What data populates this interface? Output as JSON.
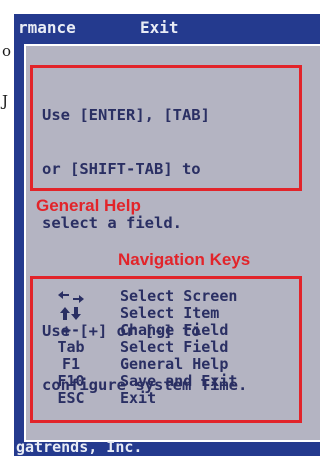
{
  "outside": {
    "frag_1": "o",
    "frag_2": "J"
  },
  "menu": {
    "tab_performance": "rmance",
    "tab_exit": "Exit"
  },
  "help": {
    "lines": [
      "Use [ENTER], [TAB]",
      "or [SHIFT-TAB] to",
      "select a field.",
      "",
      "Use [+] or [-] to",
      "configure system Time."
    ],
    "label": "General Help"
  },
  "nav": {
    "label": "Navigation Keys",
    "keys": [
      {
        "key": "",
        "icon": "left-right-arrows-icon",
        "desc": "Select Screen"
      },
      {
        "key": "",
        "icon": "up-down-arrows-icon",
        "desc": "Select Item"
      },
      {
        "key": "+-",
        "desc": "Change Field"
      },
      {
        "key": "Tab",
        "desc": "Select Field"
      },
      {
        "key": "F1",
        "desc": "General Help"
      },
      {
        "key": "F10",
        "desc": "Save and Exit"
      },
      {
        "key": "ESC",
        "desc": "Exit"
      }
    ]
  },
  "footer": {
    "text": "gatrends, Inc."
  },
  "colors": {
    "bios_blue": "#243a8e",
    "panel_gray": "#b4b4c2",
    "callout_red": "#e2242a",
    "text_navy": "#2a2f63"
  }
}
